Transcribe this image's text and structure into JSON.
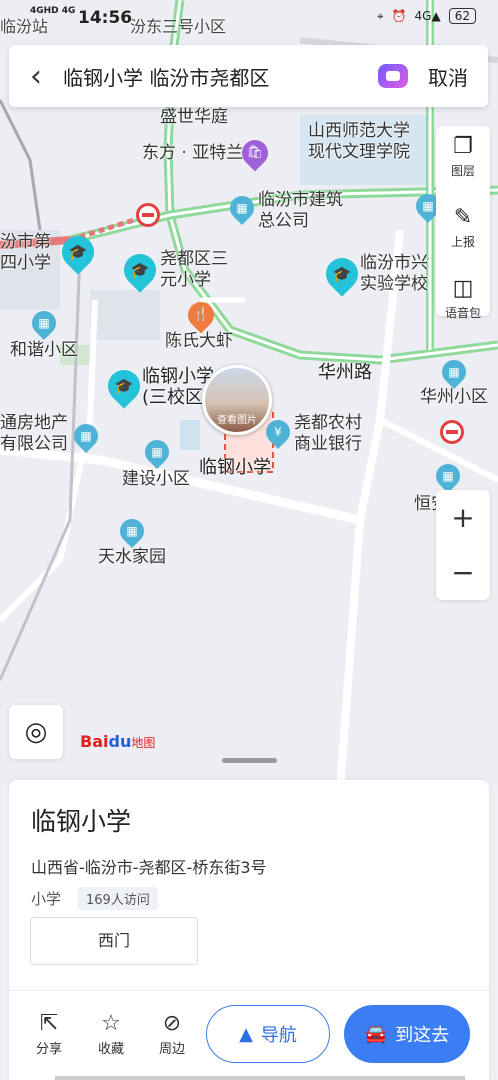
{
  "status": {
    "time": "14:56",
    "network": "4GHD 4G",
    "battery": "62"
  },
  "search": {
    "query": "临钢小学 临汾市尧都区",
    "cancel": "取消"
  },
  "map": {
    "labels": {
      "linfenzhan": "临汾站",
      "fendong": "汾东三号小区",
      "shengshi": "盛世华庭",
      "shida": "山西师范大学\n现代文理学院",
      "yatelan": "东方 · 亚特兰",
      "jianzhu": "临汾市建筑\n总公司",
      "dier": "汾市第\n四小学",
      "sanyuan": "尧都区三\n元小学",
      "xingshi": "临汾市兴\n实验学校",
      "chenshi": "陈氏大虾",
      "hexie": "和谐小区",
      "lingang3": "临钢小学\n(三校区)",
      "huazhoulu": "华州路",
      "huazhouxq": "华州小区",
      "tongfang": "通房地产\n有限公司",
      "nongcun": "尧都农村\n商业银行",
      "jianshe": "建设小区",
      "lingang": "临钢小学",
      "hengan": "恒安",
      "tianshui": "天水家园"
    },
    "photo_caption": "查看图片",
    "logo": {
      "bai": "Bai",
      "du": "du",
      "map": "地图"
    }
  },
  "toolbar": {
    "layers": "图层",
    "report": "上报",
    "voice": "语音包"
  },
  "zoom": {
    "in": "+",
    "out": "−"
  },
  "place": {
    "name": "临钢小学",
    "address": "山西省-临汾市-尧都区-桥东街3号",
    "category": "小学",
    "visits": "169人访问",
    "gate": "西门"
  },
  "actions": {
    "share": "分享",
    "favorite": "收藏",
    "nearby": "周边",
    "navigate": "导航",
    "go": "到这去"
  }
}
